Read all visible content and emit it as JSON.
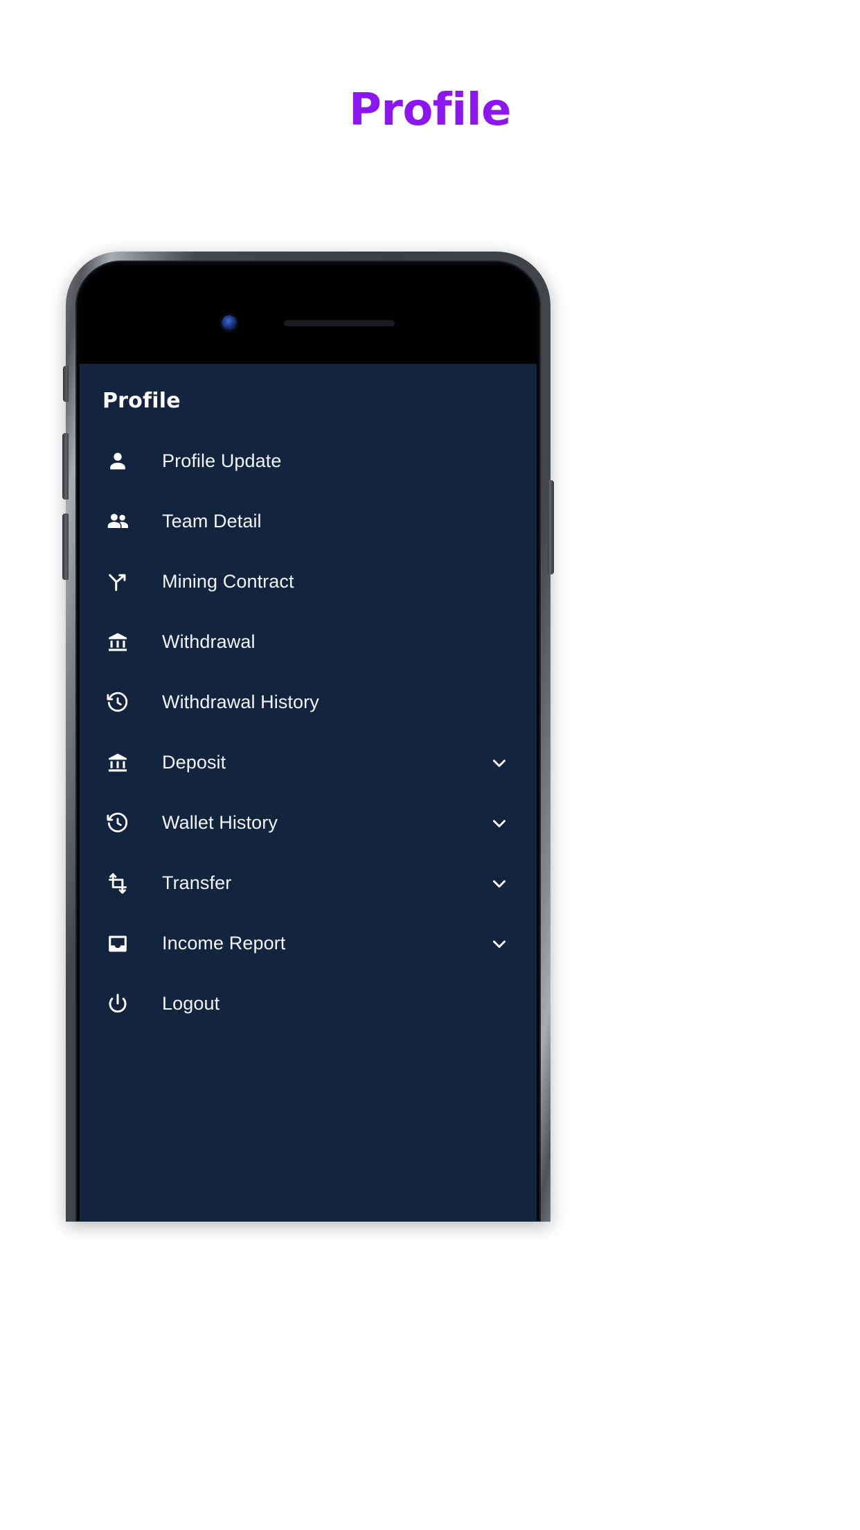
{
  "page": {
    "headline": "Profile",
    "background_color": "#ffffff",
    "headline_color": "#8B16F0"
  },
  "device": {
    "frame_color": "#43474c",
    "screen_background": "#12243e",
    "hardware_buttons": [
      "silent-switch",
      "volume-up-button",
      "volume-down-button",
      "power-button"
    ],
    "front_camera": "camera-lens",
    "earpiece": "earpiece-speaker"
  },
  "app": {
    "header": {
      "title": "Profile"
    },
    "menu": {
      "items": [
        {
          "label": "Profile Update",
          "icon": "person-icon",
          "expandable": false
        },
        {
          "label": "Team Detail",
          "icon": "people-group-icon",
          "expandable": false
        },
        {
          "label": "Mining Contract",
          "icon": "call-split-arrow-icon",
          "expandable": false
        },
        {
          "label": "Withdrawal",
          "icon": "bank-icon",
          "expandable": false
        },
        {
          "label": "Withdrawal History",
          "icon": "history-clock-icon",
          "expandable": false
        },
        {
          "label": "Deposit",
          "icon": "bank-icon",
          "expandable": true
        },
        {
          "label": "Wallet History",
          "icon": "history-clock-icon",
          "expandable": true
        },
        {
          "label": "Transfer",
          "icon": "transform-arrows-icon",
          "expandable": true
        },
        {
          "label": "Income Report",
          "icon": "inbox-icon",
          "expandable": true
        },
        {
          "label": "Logout",
          "icon": "power-icon",
          "expandable": false
        }
      ],
      "chevron_icon": "chevron-down-icon",
      "text_color": "#f2f5f9"
    }
  }
}
